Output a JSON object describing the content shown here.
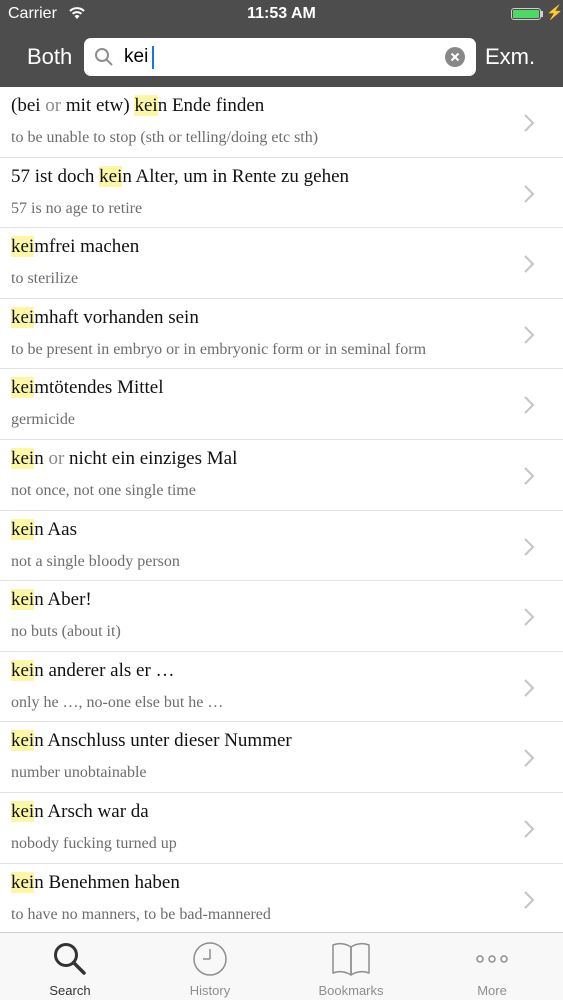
{
  "status_bar": {
    "carrier": "Carrier",
    "time": "11:53 AM",
    "battery_level": 1.0
  },
  "nav": {
    "both_label": "Both",
    "search_value": "kei",
    "exm_label": "Exm."
  },
  "results": [
    {
      "title_parts": [
        {
          "t": "(bei ",
          "s": "n"
        },
        {
          "t": "or",
          "s": "c"
        },
        {
          "t": " mit etw) ",
          "s": "n"
        },
        {
          "t": "kei",
          "s": "h"
        },
        {
          "t": "n Ende finden",
          "s": "n"
        }
      ],
      "subtitle": "to be unable to stop (sth or telling/doing etc sth)"
    },
    {
      "title_parts": [
        {
          "t": "57 ist doch ",
          "s": "n"
        },
        {
          "t": "kei",
          "s": "h"
        },
        {
          "t": "n Alter, um in Rente zu gehen",
          "s": "n"
        }
      ],
      "subtitle": "57 is no age to retire"
    },
    {
      "title_parts": [
        {
          "t": "kei",
          "s": "h"
        },
        {
          "t": "mfrei machen",
          "s": "n"
        }
      ],
      "subtitle": "to sterilize"
    },
    {
      "title_parts": [
        {
          "t": "kei",
          "s": "h"
        },
        {
          "t": "mhaft vorhanden sein",
          "s": "n"
        }
      ],
      "subtitle": "to be present in embryo or in embryonic form or in seminal form"
    },
    {
      "title_parts": [
        {
          "t": "kei",
          "s": "h"
        },
        {
          "t": "mtötendes Mittel",
          "s": "n"
        }
      ],
      "subtitle": "germicide"
    },
    {
      "title_parts": [
        {
          "t": "kei",
          "s": "h"
        },
        {
          "t": "n ",
          "s": "n"
        },
        {
          "t": "or",
          "s": "c"
        },
        {
          "t": " nicht ein einziges Mal",
          "s": "n"
        }
      ],
      "subtitle": "not once, not one single time"
    },
    {
      "title_parts": [
        {
          "t": "kei",
          "s": "h"
        },
        {
          "t": "n Aas",
          "s": "n"
        }
      ],
      "subtitle": "not a single bloody person"
    },
    {
      "title_parts": [
        {
          "t": "kei",
          "s": "h"
        },
        {
          "t": "n Aber!",
          "s": "n"
        }
      ],
      "subtitle": "no buts (about it)"
    },
    {
      "title_parts": [
        {
          "t": "kei",
          "s": "h"
        },
        {
          "t": "n anderer als er …",
          "s": "n"
        }
      ],
      "subtitle": "only he …, no-one else but he …"
    },
    {
      "title_parts": [
        {
          "t": "kei",
          "s": "h"
        },
        {
          "t": "n Anschluss unter dieser Nummer",
          "s": "n"
        }
      ],
      "subtitle": "number unobtainable"
    },
    {
      "title_parts": [
        {
          "t": "kei",
          "s": "h"
        },
        {
          "t": "n Arsch war da",
          "s": "n"
        }
      ],
      "subtitle": "nobody fucking turned up"
    },
    {
      "title_parts": [
        {
          "t": "kei",
          "s": "h"
        },
        {
          "t": "n Benehmen haben",
          "s": "n"
        }
      ],
      "subtitle": "to have no manners, to be bad-mannered"
    }
  ],
  "tabs": [
    {
      "label": "Search",
      "icon": "search-icon",
      "active": true
    },
    {
      "label": "History",
      "icon": "clock-icon",
      "active": false
    },
    {
      "label": "Bookmarks",
      "icon": "book-icon",
      "active": false
    },
    {
      "label": "More",
      "icon": "more-dots-icon",
      "active": false
    }
  ],
  "colors": {
    "header_bg": "#4d4d4d",
    "highlight": "#fbf7a7",
    "battery": "#4cd964"
  }
}
